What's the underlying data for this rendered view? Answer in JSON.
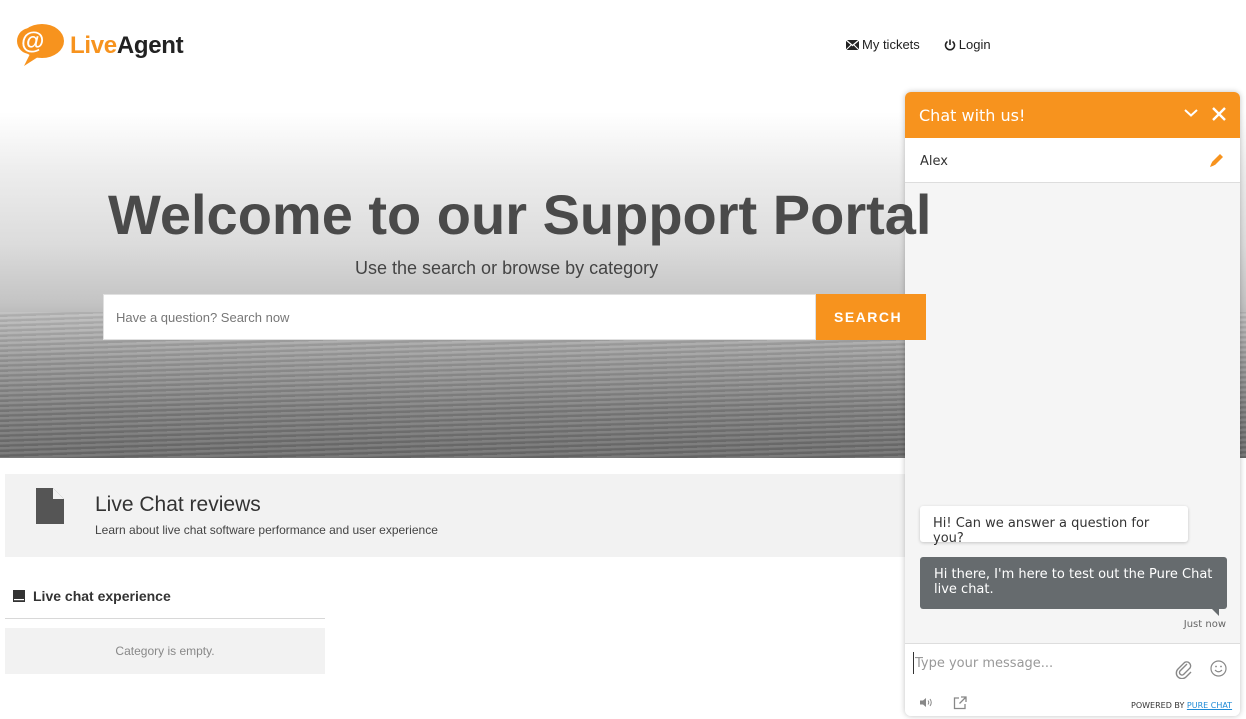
{
  "header": {
    "logo_live": "Live",
    "logo_agent": "Agent",
    "nav": {
      "my_tickets": "My tickets",
      "login": "Login"
    }
  },
  "hero": {
    "title": "Welcome to our Support Portal",
    "subtitle": "Use the search or browse by category",
    "search_placeholder": "Have a question? Search now",
    "search_button": "SEARCH"
  },
  "category": {
    "title": "Live Chat reviews",
    "description": "Learn about live chat software performance and user experience"
  },
  "section": {
    "title": "Live chat experience",
    "empty_text": "Category is empty."
  },
  "chat": {
    "title": "Chat with us!",
    "visitor_name": "Alex",
    "messages": [
      {
        "from": "agent",
        "text": "Hi! Can we answer a question for you?"
      },
      {
        "from": "visitor",
        "text": "Hi there, I'm here to test out the Pure Chat live chat."
      }
    ],
    "last_time": "Just now",
    "input_placeholder": "Type your message...",
    "powered_by": "POWERED BY ",
    "powered_link": "PURE CHAT"
  },
  "colors": {
    "accent": "#f7931e",
    "visitor_bubble": "#666b6e",
    "link": "#1e8ad6"
  }
}
